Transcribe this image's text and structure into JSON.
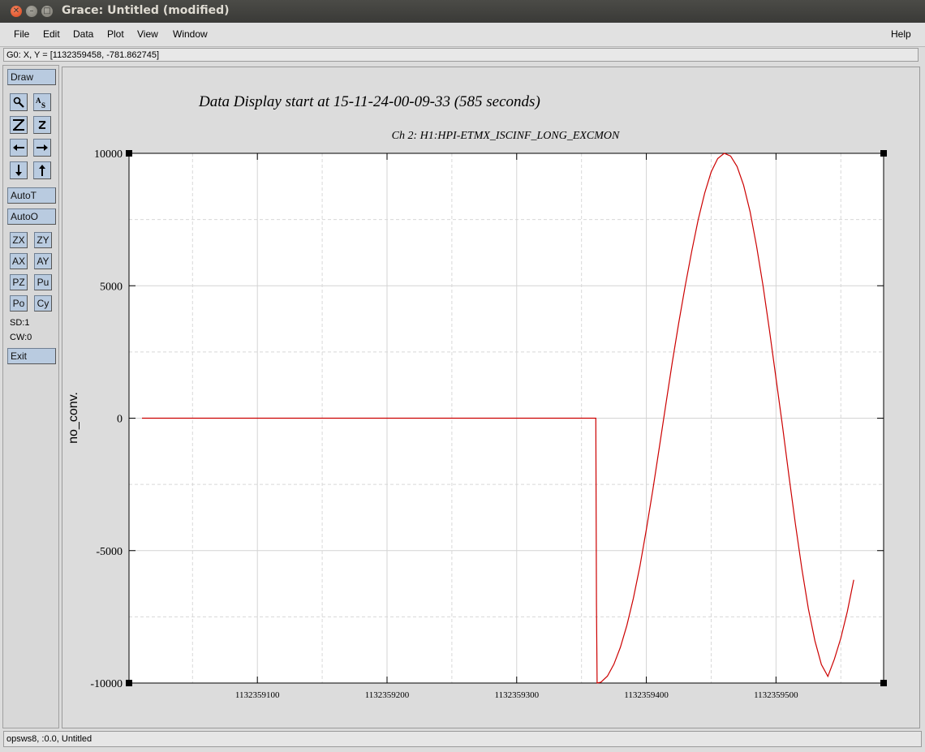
{
  "window": {
    "title": "Grace: Untitled (modified)"
  },
  "menubar": {
    "items": [
      "File",
      "Edit",
      "Data",
      "Plot",
      "View",
      "Window"
    ],
    "help": "Help"
  },
  "locator": {
    "text": "G0: X, Y = [1132359458, -781.862745]"
  },
  "toolbar": {
    "draw": "Draw",
    "autot": "AutoT",
    "autoo": "AutoO",
    "zx": "ZX",
    "zy": "ZY",
    "ax": "AX",
    "ay": "AY",
    "pz": "PZ",
    "pu": "Pu",
    "po": "Po",
    "cy": "Cy",
    "sd": "SD:1",
    "cw": "CW:0",
    "exit": "Exit",
    "icons": [
      "zoom-icon",
      "text-icon",
      "autoscale-icon",
      "zoom-z-icon",
      "left-arrow-icon",
      "right-arrow-icon",
      "down-arrow-icon",
      "up-arrow-icon"
    ]
  },
  "status": {
    "text": "opsws8, :0.0, Untitled"
  },
  "chart_data": {
    "type": "line",
    "title": "Data Display start at 15-11-24-00-09-33 (585 seconds)",
    "subtitle": "Ch 2: H1:HPI-ETMX_ISCINF_LONG_EXCMON",
    "xlabel": "",
    "ylabel": "no_conv.",
    "xlim": [
      1132359001,
      1132359583
    ],
    "ylim": [
      -10000,
      10000
    ],
    "xticks": [
      1132359100,
      1132359200,
      1132359300,
      1132359400,
      1132359500
    ],
    "xtick_labels": [
      "1132359100",
      "1132359200",
      "1132359300",
      "1132359400",
      "1132359500"
    ],
    "yticks": [
      -10000,
      -5000,
      0,
      5000,
      10000
    ],
    "ytick_labels": [
      "-10000",
      "-5000",
      "0",
      "5000",
      "10000"
    ],
    "grid": true,
    "line_color": "#cc0000",
    "series": [
      {
        "points": [
          [
            1132359011,
            0
          ],
          [
            1132359361,
            0
          ],
          [
            1132359361.5,
            -7000
          ],
          [
            1132359362,
            -10000
          ],
          [
            1132359365,
            -9970
          ],
          [
            1132359370,
            -9740
          ],
          [
            1132359375,
            -9290
          ],
          [
            1132359380,
            -8650
          ],
          [
            1132359385,
            -7820
          ],
          [
            1132359390,
            -6800
          ],
          [
            1132359395,
            -5600
          ],
          [
            1132359400,
            -4200
          ],
          [
            1132359405,
            -2700
          ],
          [
            1132359410,
            -1100
          ],
          [
            1132359415,
            500
          ],
          [
            1132359420,
            2100
          ],
          [
            1132359425,
            3600
          ],
          [
            1132359430,
            5000
          ],
          [
            1132359435,
            6300
          ],
          [
            1132359440,
            7500
          ],
          [
            1132359445,
            8500
          ],
          [
            1132359450,
            9300
          ],
          [
            1132359455,
            9800
          ],
          [
            1132359460,
            10000
          ],
          [
            1132359465,
            9900
          ],
          [
            1132359470,
            9500
          ],
          [
            1132359475,
            8800
          ],
          [
            1132359480,
            7800
          ],
          [
            1132359485,
            6500
          ],
          [
            1132359490,
            5000
          ],
          [
            1132359495,
            3300
          ],
          [
            1132359500,
            1500
          ],
          [
            1132359505,
            -300
          ],
          [
            1132359510,
            -2200
          ],
          [
            1132359515,
            -4000
          ],
          [
            1132359520,
            -5700
          ],
          [
            1132359525,
            -7200
          ],
          [
            1132359530,
            -8400
          ],
          [
            1132359535,
            -9300
          ],
          [
            1132359540,
            -9750
          ],
          [
            1132359545,
            -9100
          ],
          [
            1132359550,
            -8300
          ],
          [
            1132359555,
            -7300
          ],
          [
            1132359560,
            -6100
          ]
        ]
      }
    ]
  }
}
